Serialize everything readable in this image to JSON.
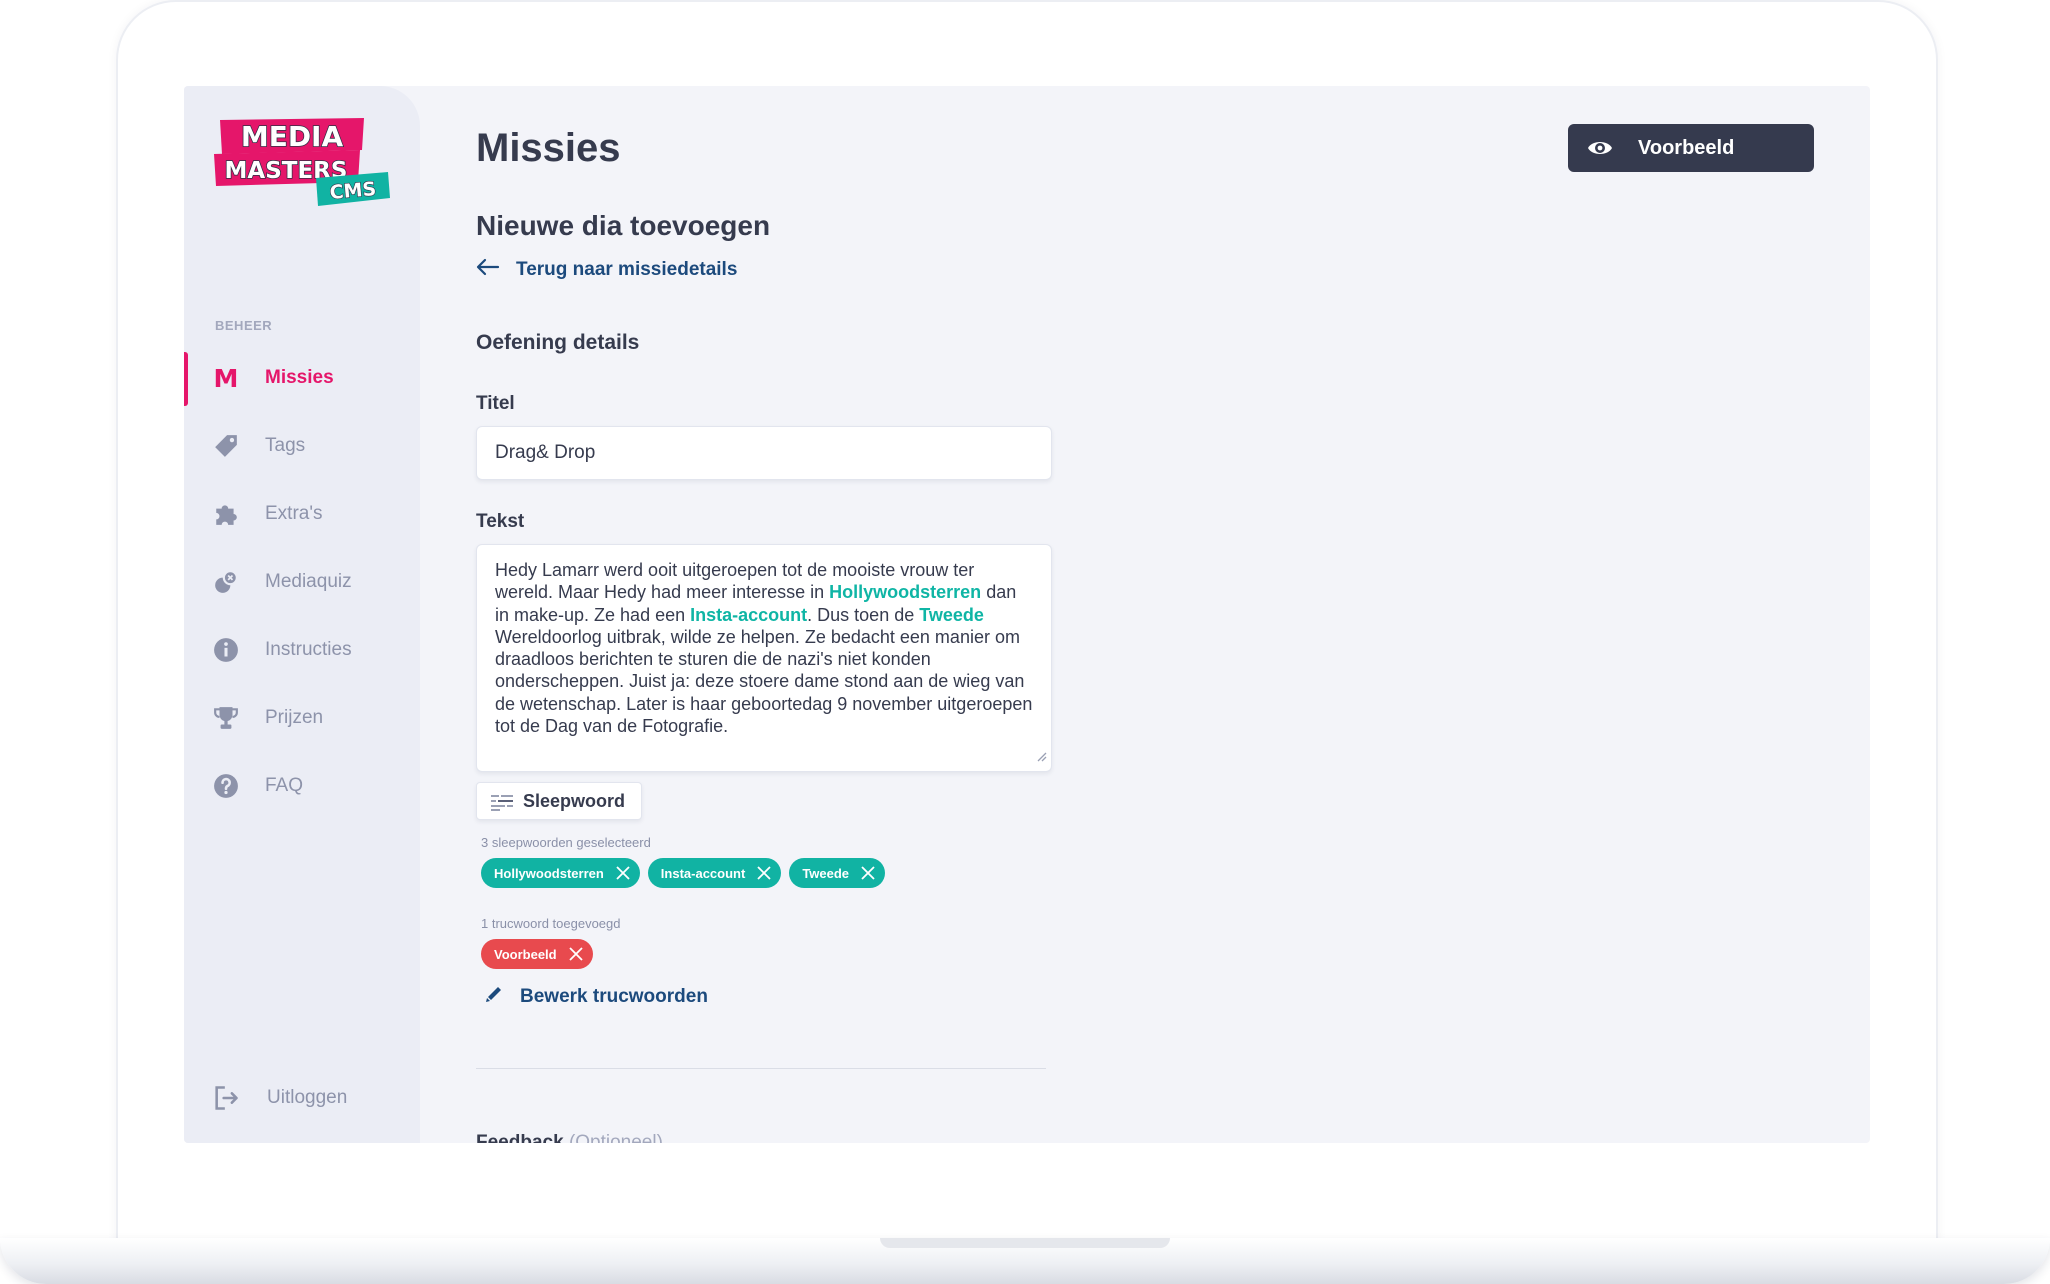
{
  "app": {
    "logo_line1": "MEDIA",
    "logo_line2": "MASTERS",
    "logo_badge": "CMS"
  },
  "sidebar": {
    "section_label": "BEHEER",
    "items": [
      {
        "label": "Missies",
        "icon": "m-logo-icon",
        "active": true
      },
      {
        "label": "Tags",
        "icon": "tag-icon"
      },
      {
        "label": "Extra's",
        "icon": "puzzle-icon"
      },
      {
        "label": "Mediaquiz",
        "icon": "quiz-icon"
      },
      {
        "label": "Instructies",
        "icon": "info-icon"
      },
      {
        "label": "Prijzen",
        "icon": "trophy-icon"
      },
      {
        "label": "FAQ",
        "icon": "question-icon"
      }
    ],
    "logout_label": "Uitloggen"
  },
  "header": {
    "title": "Missies",
    "preview_button": "Voorbeeld"
  },
  "form": {
    "subtitle": "Nieuwe dia toevoegen",
    "back_link": "Terug naar missiedetails",
    "section_title": "Oefening details",
    "title_label": "Titel",
    "title_value": "Drag& Drop",
    "text_label": "Tekst",
    "text_parts": {
      "p1": "Hedy Lamarr werd ooit uitgeroepen tot de mooiste vrouw ter wereld. Maar Hedy had meer interesse in ",
      "h1": "Hollywoodsterren",
      "p2": " dan in make-up. Ze had een ",
      "h2": "Insta-account",
      "p3": ". Dus toen de ",
      "h3": "Tweede",
      "p4": " Wereldoorlog uitbrak, wilde ze helpen. Ze bedacht een manier om draadloos berichten te sturen die de nazi's niet konden onderscheppen. Juist ja: deze stoere dame stond aan de wieg van de wetenschap. Later is haar geboortedag 9 november uitgeroepen tot de Dag van de Fotografie."
    },
    "drag_word_button": "Sleepwoord",
    "drag_words_count": "3 sleepwoorden geselecteerd",
    "drag_words": [
      "Hollywoodsterren",
      "Insta-account",
      "Tweede"
    ],
    "trick_words_count": "1 trucwoord toegevoegd",
    "trick_words": [
      "Voorbeeld"
    ],
    "edit_trick_words": "Bewerk trucwoorden",
    "feedback_label": "Feedback",
    "feedback_optional": "(Optioneel)"
  },
  "colors": {
    "accent": "#e5166a",
    "teal": "#11b3a3",
    "red": "#e84a4e",
    "dark": "#353a4e",
    "link": "#1c4a7d"
  }
}
